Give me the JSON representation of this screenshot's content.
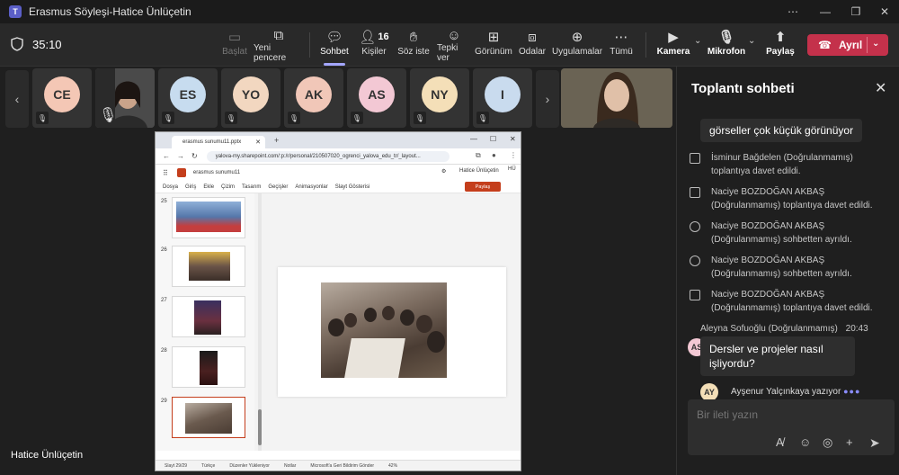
{
  "window": {
    "title": "Erasmus Söyleşi-Hatice Ünlüçetin",
    "controls": [
      "⋯",
      "—",
      "❐",
      "✕"
    ]
  },
  "toolbar": {
    "timer": "35:10",
    "start_label": "Başlat",
    "new_window_label": "Yeni pencere",
    "chat_label": "Sohbet",
    "people_label": "Kişiler",
    "people_count": "16",
    "raise_label": "Söz iste",
    "react_label": "Tepki ver",
    "view_label": "Görünüm",
    "rooms_label": "Odalar",
    "apps_label": "Uygulamalar",
    "more_label": "Tümü",
    "camera_label": "Kamera",
    "mic_label": "Mikrofon",
    "share_label": "Paylaş",
    "leave_label": "Ayrıl"
  },
  "participants": [
    {
      "initials": "CE",
      "color": "#f4c7b5"
    },
    {
      "initials": "ES",
      "color": "#c7dcef"
    },
    {
      "initials": "YO",
      "color": "#f2d7c0"
    },
    {
      "initials": "AK",
      "color": "#f1c7b8"
    },
    {
      "initials": "AS",
      "color": "#f3c8d4"
    },
    {
      "initials": "NY",
      "color": "#f4dfb8"
    },
    {
      "initials": "I",
      "color": "#c9dbee"
    }
  ],
  "presenter_name": "Hatice Ünlüçetin",
  "browser": {
    "tab_title": "erasmus sunumu11.pptx",
    "url": "yalova-my.sharepoint.com/:p:/r/personal/210507020_ogrenci_yalova_edu_tr/_layout...",
    "ppt_name": "erasmus sunumu11",
    "user_name": "Hatice Ünlüçetin",
    "user_initials": "HÜ",
    "menu": [
      "Dosya",
      "Giriş",
      "Ekle",
      "Çizim",
      "Tasarım",
      "Geçişler",
      "Animasyonlar",
      "Slayt Gösterisi"
    ],
    "share_label": "Paylaş",
    "thumbs": [
      "25",
      "26",
      "27",
      "28",
      "29"
    ],
    "status": [
      "Slayt 29/29",
      "Türkçe",
      "Düzenler Yükleniyor",
      "Notlar",
      "Microsoft'a Geri Bildirim Gönder",
      "42%"
    ]
  },
  "chat": {
    "title": "Toplantı sohbeti",
    "bubble_top": "görseller çok küçük görünüyor",
    "system_messages": [
      {
        "text": "İsminur Bağdelen (Doğrulanmamış) toplantıya davet edildi.",
        "icon": "invite-icon"
      },
      {
        "text": "Naciye BOZDOĞAN AKBAŞ (Doğrulanmamış) toplantıya davet edildi.",
        "icon": "invite-icon"
      },
      {
        "text": "Naciye BOZDOĞAN AKBAŞ (Doğrulanmamış) sohbetten ayrıldı.",
        "icon": "person-left-icon"
      },
      {
        "text": "Naciye BOZDOĞAN AKBAŞ (Doğrulanmamış) sohbetten ayrıldı.",
        "icon": "person-left-icon"
      },
      {
        "text": "Naciye BOZDOĞAN AKBAŞ (Doğrulanmamış) toplantıya davet edildi.",
        "icon": "invite-icon"
      }
    ],
    "sender": "Aleyna Sofuoğlu (Doğrulanmamış)",
    "sender_time": "20:43",
    "sender_initials": "AS",
    "message": "Dersler ve projeler nasıl işliyordu?",
    "typing_initials": "AY",
    "typing_text": "Ayşenur Yalçınkaya yazıyor",
    "compose_placeholder": "Bir ileti yazın"
  }
}
